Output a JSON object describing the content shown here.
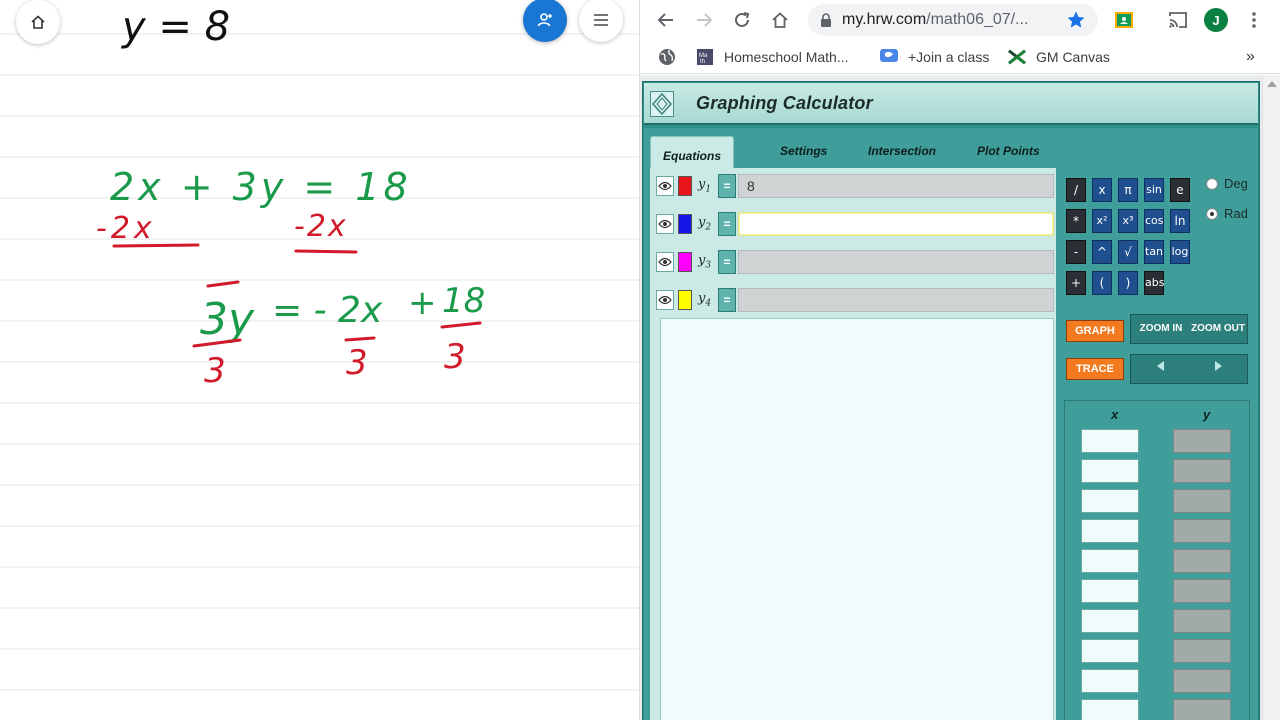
{
  "whiteboard": {
    "handwriting": {
      "line1": "y = 8",
      "equation": "2x + 3y = 18",
      "subtract_left": "-2x",
      "subtract_right": "-2x",
      "rearranged_left": "3y",
      "rearranged_mid": "= - 2x",
      "rearranged_plus": "+",
      "rearranged_right": "18",
      "denom_left": "3",
      "denom_mid": "3",
      "denom_right": "3"
    },
    "ink_colors": {
      "black": "#111111",
      "green": "#1a9a4a",
      "red": "#d11a2a"
    }
  },
  "browser": {
    "url_host": "my.hrw.com",
    "url_path": "/math06_07/...",
    "profile_initial": "J",
    "bookmarks": [
      {
        "label": "Homeschool Math..."
      },
      {
        "label": "+Join a class"
      },
      {
        "label": "GM Canvas"
      }
    ],
    "more_bookmarks": "»"
  },
  "calculator": {
    "title": "Graphing Calculator",
    "tabs": [
      "Equations",
      "Settings",
      "Intersection",
      "Plot Points"
    ],
    "equations": [
      {
        "label": "y",
        "sub": "1",
        "color": "#e8161b",
        "value": "8"
      },
      {
        "label": "y",
        "sub": "2",
        "color": "#1515e8",
        "value": ""
      },
      {
        "label": "y",
        "sub": "3",
        "color": "#ff00ff",
        "value": ""
      },
      {
        "label": "y",
        "sub": "4",
        "color": "#ffff00",
        "value": ""
      }
    ],
    "eq_button_label": "=",
    "keys": {
      "row1": [
        "/",
        "x",
        "π",
        "sin",
        "e"
      ],
      "row2": [
        "*",
        "x²",
        "x³",
        "cos",
        "ln"
      ],
      "row3": [
        "-",
        "^",
        "√",
        "tan",
        "log"
      ],
      "row4": [
        "+",
        "(",
        ")",
        "abs"
      ]
    },
    "angle_modes": [
      {
        "label": "Deg",
        "selected": false
      },
      {
        "label": "Rad",
        "selected": true
      }
    ],
    "graph_label": "GRAPH",
    "trace_label": "TRACE",
    "zoom_in_label": "ZOOM IN",
    "zoom_out_label": "ZOOM OUT",
    "table_headers": {
      "x": "x",
      "y": "y"
    },
    "table_rows": 10
  }
}
